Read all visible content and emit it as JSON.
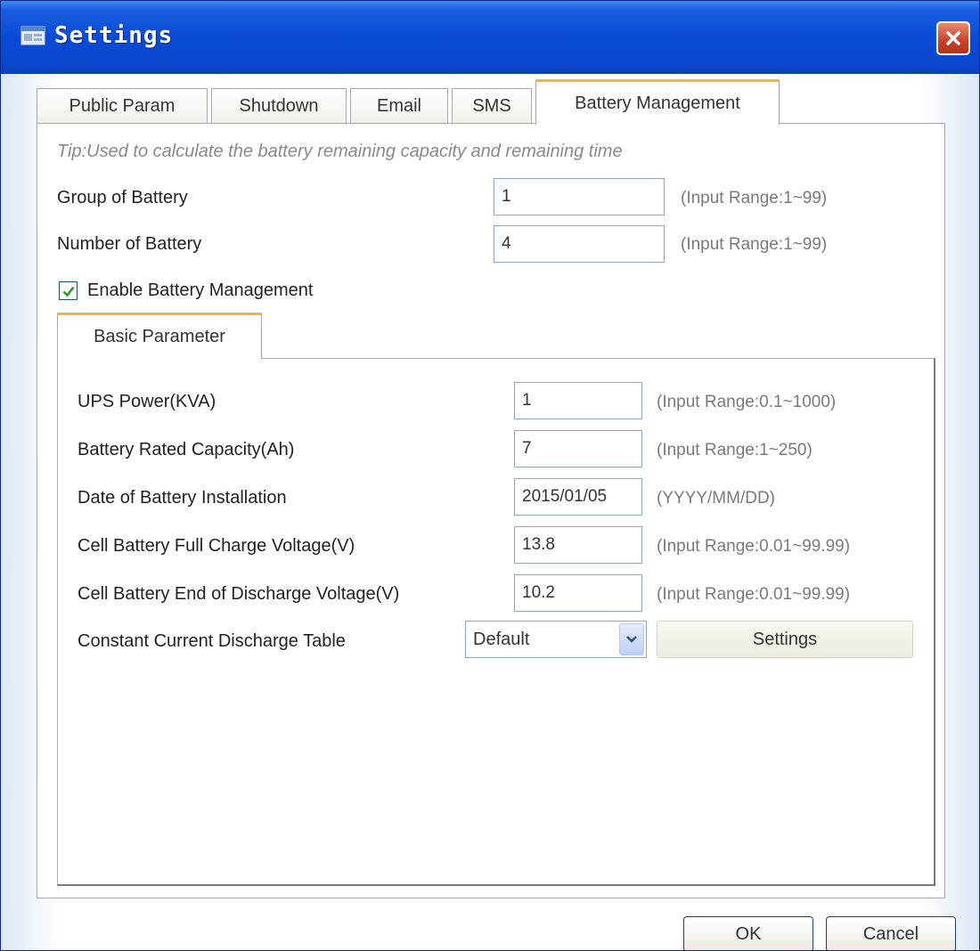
{
  "window": {
    "title": "Settings"
  },
  "tabs": [
    {
      "label": "Public Param"
    },
    {
      "label": "Shutdown"
    },
    {
      "label": "Email"
    },
    {
      "label": "SMS"
    },
    {
      "label": "Battery Management",
      "active": true
    }
  ],
  "battery": {
    "tip": "Tip:Used to calculate the battery remaining capacity and remaining time",
    "group": {
      "label": "Group of Battery",
      "value": "1",
      "hint": "(Input Range:1~99)"
    },
    "number": {
      "label": "Number of Battery",
      "value": "4",
      "hint": "(Input Range:1~99)"
    },
    "enable": {
      "label": "Enable Battery Management",
      "checked": true
    },
    "subtab": {
      "label": "Basic Parameter"
    },
    "params": {
      "ups_power": {
        "label": "UPS Power(KVA)",
        "value": "1",
        "hint": "(Input Range:0.1~1000)"
      },
      "capacity": {
        "label": "Battery Rated Capacity(Ah)",
        "value": "7",
        "hint": "(Input Range:1~250)"
      },
      "install_date": {
        "label": "Date of Battery Installation",
        "value": "2015/01/05",
        "hint": "(YYYY/MM/DD)"
      },
      "full_charge": {
        "label": "Cell Battery Full Charge Voltage(V)",
        "value": "13.8",
        "hint": "(Input Range:0.01~99.99)"
      },
      "end_discharge": {
        "label": "Cell Battery End of Discharge Voltage(V)",
        "value": "10.2",
        "hint": "(Input Range:0.01~99.99)"
      },
      "discharge_table": {
        "label": "Constant Current Discharge Table",
        "value": "Default",
        "button": "Settings"
      }
    }
  },
  "buttons": {
    "ok": "OK",
    "cancel": "Cancel"
  },
  "colors": {
    "titlebar": "#0a4bd6",
    "tab_highlight": "#f4b43b",
    "close": "#c7412a",
    "check": "#22a022"
  },
  "icons": {
    "app": "app-window-icon",
    "close": "close-icon",
    "check": "checkmark-icon",
    "dropdown": "chevron-down-icon"
  }
}
